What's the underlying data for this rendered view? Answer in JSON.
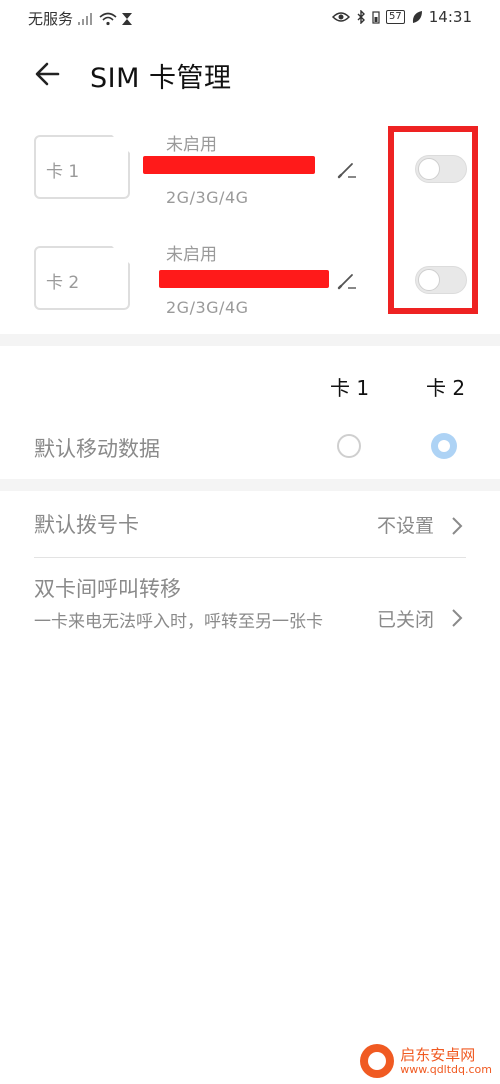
{
  "status_bar": {
    "carrier": "无服务",
    "battery": "57",
    "time": "14:31"
  },
  "header": {
    "title": "SIM 卡管理"
  },
  "sims": [
    {
      "label": "卡 1",
      "status": "未启用",
      "network": "2G/3G/4G",
      "enabled": false
    },
    {
      "label": "卡 2",
      "status": "未启用",
      "network": "2G/3G/4G",
      "enabled": false
    }
  ],
  "default_data": {
    "col1": "卡 1",
    "col2": "卡 2",
    "label": "默认移动数据",
    "selected": "卡 2"
  },
  "settings": {
    "default_dial_label": "默认拨号卡",
    "default_dial_value": "不设置",
    "call_forward_label": "双卡间呼叫转移",
    "call_forward_desc": "一卡来电无法呼入时，呼转至另一张卡",
    "call_forward_value": "已关闭"
  },
  "watermark": {
    "name": "启东安卓网",
    "url": "www.qdltdq.com"
  },
  "colors": {
    "accent": "#aed3f5",
    "highlight": "#ee2222",
    "redact": "#ff1a1a"
  }
}
